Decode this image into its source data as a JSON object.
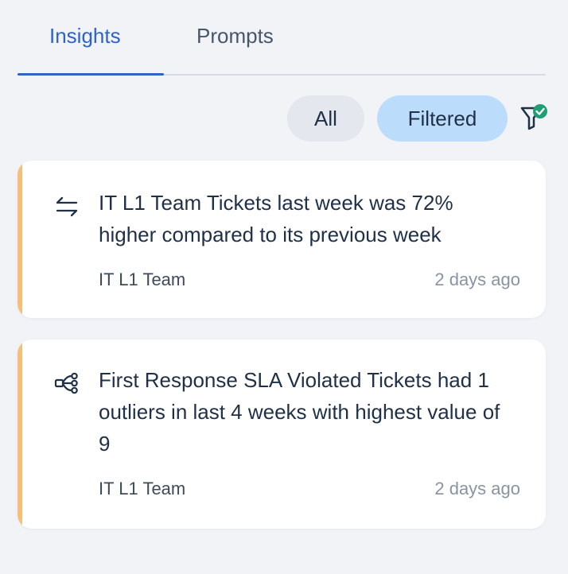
{
  "tabs": [
    {
      "label": "Insights",
      "active": true
    },
    {
      "label": "Prompts",
      "active": false
    }
  ],
  "filters": {
    "all_label": "All",
    "filtered_label": "Filtered",
    "selected": "Filtered",
    "filter_icon": "funnel-check-icon"
  },
  "insights": [
    {
      "icon": "compare-arrows-icon",
      "title": "IT L1 Team Tickets last week was 72% higher compared to its previous week",
      "source": "IT L1 Team",
      "time": "2 days ago"
    },
    {
      "icon": "outliers-icon",
      "title": "First Response SLA Violated Tickets had 1 outliers in last 4 weeks with highest value of 9",
      "source": "IT L1 Team",
      "time": "2 days ago"
    }
  ],
  "colors": {
    "accent": "#2f63c9",
    "filtered_pill": "#bcdcfb",
    "card_stripe": "#f5bf78",
    "check_badge": "#1f9e74"
  }
}
